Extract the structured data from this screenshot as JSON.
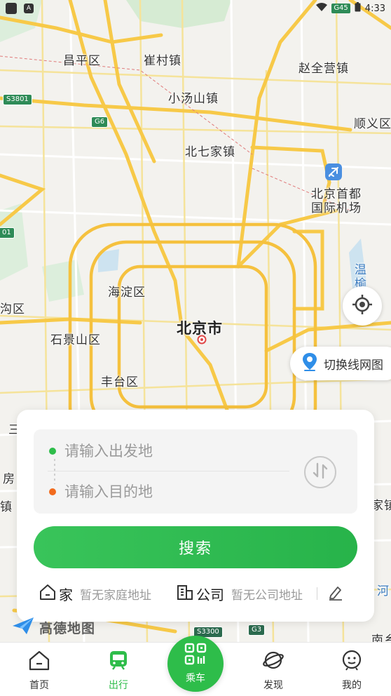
{
  "status_bar": {
    "time": "4:33",
    "road_badge": "G45"
  },
  "map": {
    "labels": {
      "changping": "昌平区",
      "cuicun": "崔村镇",
      "zhaoquanying": "赵全营镇",
      "xiaotangshan": "小汤山镇",
      "shunyi": "顺义区",
      "beiqijia": "北七家镇",
      "airport_line1": "北京首都",
      "airport_line2": "国际机场",
      "haidian": "海淀区",
      "city": "北京市",
      "shijingshan": "石景山区",
      "fengtai": "丰台区",
      "goukou": "沟区",
      "wen": "温",
      "yu": "榆",
      "fang": "房",
      "zhen": "镇",
      "jiazhen": "家镇",
      "nanzhen": "南乡",
      "he": "河",
      "left_san": "三"
    },
    "shields": {
      "s3801": "S3801",
      "g6": "G6",
      "s3300": "S3300",
      "g3": "G3",
      "x01": "01"
    }
  },
  "controls": {
    "switch_map_label": "切换线网图"
  },
  "search_card": {
    "start_placeholder": "请输入出发地",
    "end_placeholder": "请输入目的地",
    "search_label": "搜索",
    "home_label": "家",
    "home_sub": "暂无家庭地址",
    "company_label": "公司",
    "company_sub": "暂无公司地址"
  },
  "brand": {
    "name": "高德地图"
  },
  "tabs": {
    "home": "首页",
    "travel": "出行",
    "ride": "乘车",
    "discover": "发现",
    "mine": "我的"
  },
  "colors": {
    "accent": "#2ebd4a",
    "origin_dot": "#2ebd4a",
    "dest_dot": "#f26b1d",
    "road": "#f7c948"
  }
}
